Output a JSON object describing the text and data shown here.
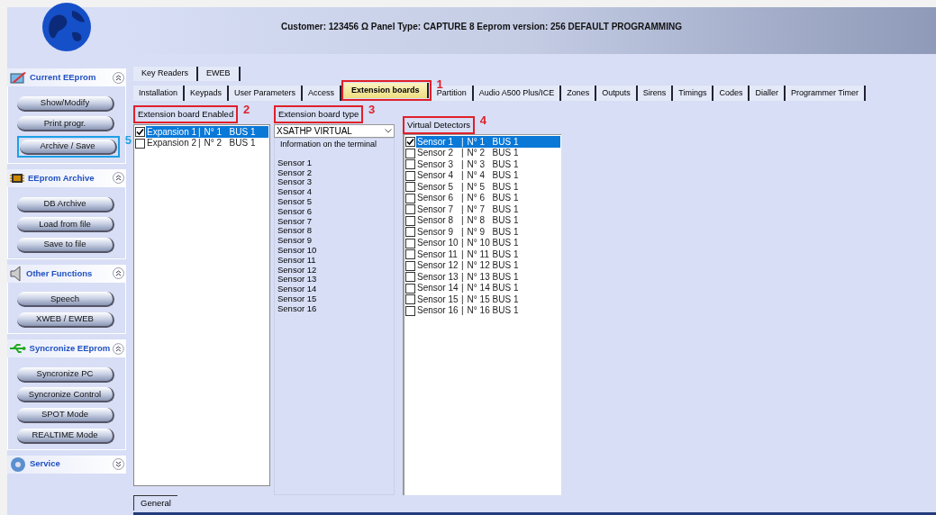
{
  "header": {
    "title": "Customer: 123456 Ω Panel Type: CAPTURE 8 Eeprom version: 256  DEFAULT PROGRAMMING"
  },
  "sidebar": {
    "sections": [
      {
        "title": "Current EEprom",
        "kind": "pencil",
        "expanded": true,
        "buttons": [
          {
            "label": "Show/Modify"
          },
          {
            "label": "Print progr."
          },
          {
            "label": "Archive / Save",
            "annotation": {
              "number": "5",
              "color": "#1ea0e6"
            }
          }
        ]
      },
      {
        "title": "EEprom Archive",
        "kind": "chip",
        "expanded": true,
        "buttons": [
          {
            "label": "DB Archive"
          },
          {
            "label": "Load from file"
          },
          {
            "label": "Save to file"
          }
        ]
      },
      {
        "title": "Other Functions",
        "kind": "speaker",
        "expanded": true,
        "buttons": [
          {
            "label": "Speech"
          },
          {
            "label": "XWEB / EWEB"
          }
        ]
      },
      {
        "title": "Syncronize EEprom",
        "kind": "usb",
        "expanded": true,
        "buttons": [
          {
            "label": "Syncronize PC"
          },
          {
            "label": "Syncronize Control"
          },
          {
            "label": "SPOT Mode"
          },
          {
            "label": "REALTIME Mode"
          }
        ]
      },
      {
        "title": "Service",
        "kind": "gear",
        "expanded": false
      }
    ]
  },
  "tabs_row_1": [
    {
      "label": "Key Readers",
      "selected": false
    },
    {
      "label": "EWEB",
      "selected": false
    }
  ],
  "tabs_row_2": [
    {
      "label": "Installation",
      "selected": false
    },
    {
      "label": "Keypads",
      "selected": false
    },
    {
      "label": "User Parameters",
      "selected": false
    },
    {
      "label": "Access",
      "selected": false
    },
    {
      "label": "Extension boards",
      "selected": true,
      "annotation": {
        "number": "1",
        "color": "#e0202a"
      }
    },
    {
      "label": "Partition",
      "selected": false
    },
    {
      "label": "Audio A500 Plus/ICE",
      "selected": false
    },
    {
      "label": "Zones",
      "selected": false
    },
    {
      "label": "Outputs",
      "selected": false
    },
    {
      "label": "Sirens",
      "selected": false
    },
    {
      "label": "Timings",
      "selected": false
    },
    {
      "label": "Codes",
      "selected": false
    },
    {
      "label": "Dialler",
      "selected": false
    },
    {
      "label": "Programmer Timer",
      "selected": false
    }
  ],
  "boards_enabled": {
    "label": "Extension board Enabled",
    "annotation": {
      "number": "2",
      "color": "#e0202a"
    },
    "items": [
      {
        "name": "Expansion 1",
        "separator": "|",
        "number": "N° 1",
        "bus": "BUS 1",
        "checked": true,
        "selected": true
      },
      {
        "name": "Expansion 2",
        "separator": "|",
        "number": "N° 2",
        "bus": "BUS 1",
        "checked": false,
        "selected": false
      }
    ]
  },
  "board_type": {
    "label": "Extension board type",
    "annotation": {
      "number": "3",
      "color": "#e0202a"
    },
    "value": "XSATHP VIRTUAL",
    "info_label": "Information on the terminal",
    "info_lines": [
      "Sensor 1",
      "Sensor 2",
      "Sensor 3",
      "Sensor 4",
      "Sensor 5",
      "Sensor 6",
      "Sensor 7",
      "Sensor 8",
      "Sensor 9",
      "Sensor 10",
      "Sensor 11",
      "Sensor 12",
      "Sensor 13",
      "Sensor 14",
      "Sensor 15",
      "Sensor 16"
    ]
  },
  "virtual_detectors": {
    "label": "Virtual Detectors",
    "annotation": {
      "number": "4",
      "color": "#e0202a"
    },
    "items": [
      {
        "name": "Sensor 1",
        "separator": "|",
        "number": "N° 1",
        "bus": "BUS 1",
        "checked": true,
        "selected": true
      },
      {
        "name": "Sensor 2",
        "separator": "|",
        "number": "N° 2",
        "bus": "BUS 1",
        "checked": false,
        "selected": false
      },
      {
        "name": "Sensor 3",
        "separator": "|",
        "number": "N° 3",
        "bus": "BUS 1",
        "checked": false,
        "selected": false
      },
      {
        "name": "Sensor 4",
        "separator": "|",
        "number": "N° 4",
        "bus": "BUS 1",
        "checked": false,
        "selected": false
      },
      {
        "name": "Sensor 5",
        "separator": "|",
        "number": "N° 5",
        "bus": "BUS 1",
        "checked": false,
        "selected": false
      },
      {
        "name": "Sensor 6",
        "separator": "|",
        "number": "N° 6",
        "bus": "BUS 1",
        "checked": false,
        "selected": false
      },
      {
        "name": "Sensor 7",
        "separator": "|",
        "number": "N° 7",
        "bus": "BUS 1",
        "checked": false,
        "selected": false
      },
      {
        "name": "Sensor 8",
        "separator": "|",
        "number": "N° 8",
        "bus": "BUS 1",
        "checked": false,
        "selected": false
      },
      {
        "name": "Sensor 9",
        "separator": "|",
        "number": "N° 9",
        "bus": "BUS 1",
        "checked": false,
        "selected": false
      },
      {
        "name": "Sensor 10",
        "separator": "|",
        "number": "N° 10",
        "bus": "BUS 1",
        "checked": false,
        "selected": false
      },
      {
        "name": "Sensor 11",
        "separator": "|",
        "number": "N° 11",
        "bus": "BUS 1",
        "checked": false,
        "selected": false
      },
      {
        "name": "Sensor 12",
        "separator": "|",
        "number": "N° 12",
        "bus": "BUS 1",
        "checked": false,
        "selected": false
      },
      {
        "name": "Sensor 13",
        "separator": "|",
        "number": "N° 13",
        "bus": "BUS 1",
        "checked": false,
        "selected": false
      },
      {
        "name": "Sensor 14",
        "separator": "|",
        "number": "N° 14",
        "bus": "BUS 1",
        "checked": false,
        "selected": false
      },
      {
        "name": "Sensor 15",
        "separator": "|",
        "number": "N° 15",
        "bus": "BUS 1",
        "checked": false,
        "selected": false
      },
      {
        "name": "Sensor 16",
        "separator": "|",
        "number": "N° 16",
        "bus": "BUS 1",
        "checked": false,
        "selected": false
      }
    ]
  },
  "bottom_tabs": [
    {
      "label": "General",
      "selected": true
    }
  ]
}
